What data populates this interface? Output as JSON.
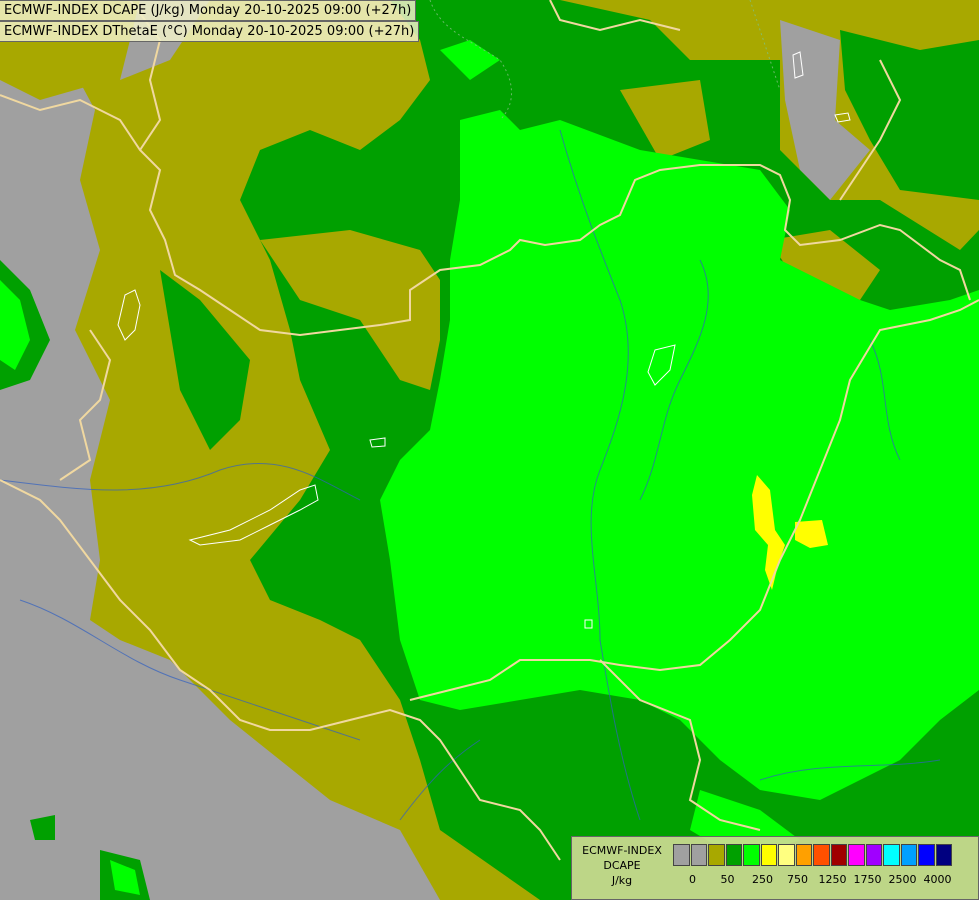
{
  "titles": {
    "line1": "ECMWF-INDEX DCAPE (J/kg) Monday 20-10-2025 09:00 (+27h)",
    "line2": "ECMWF-INDEX DThetaE (°C) Monday 20-10-2025 09:00 (+27h)"
  },
  "legend": {
    "label_line1": "ECMWF-INDEX",
    "label_line2": "DCAPE",
    "label_line3": "J/kg",
    "colors": [
      "#a0a0a0",
      "#a0a0a0",
      "#a8a800",
      "#00a000",
      "#00ff00",
      "#ffff00",
      "#ffff80",
      "#ffa000",
      "#ff5000",
      "#a00000",
      "#ff00ff",
      "#a000ff",
      "#00ffff",
      "#00a0ff",
      "#0000ff",
      "#000080"
    ],
    "ticks": [
      "0",
      "50",
      "250",
      "750",
      "1250",
      "1750",
      "2500",
      "4000"
    ]
  },
  "map_colors": {
    "grey": "#a0a0a0",
    "olive": "#a8a800",
    "dark_green": "#00a000",
    "bright_green": "#00ff00",
    "yellow": "#ffff00",
    "border": "#f0d8a0",
    "river": "#3060c0"
  }
}
